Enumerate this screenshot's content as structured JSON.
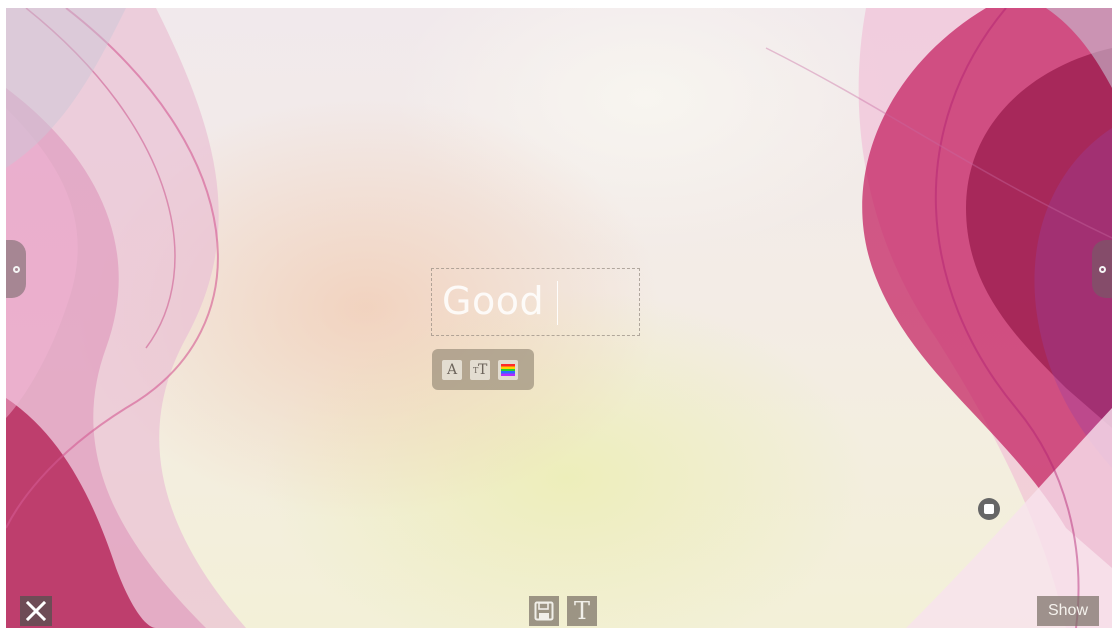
{
  "canvas": {
    "text_value": "Good"
  },
  "format_toolbar": {
    "font_button_label": "A",
    "size_button_small": "T",
    "size_button_big": "T",
    "color_button_icon": "rainbow-color-icon"
  },
  "side_handles": {
    "left_icon": "settings-dot-icon",
    "right_icon": "settings-dot-icon"
  },
  "record_indicator": {
    "icon": "stop-icon"
  },
  "bottom_bar": {
    "close_icon": "close-icon",
    "save_icon": "save-icon",
    "text_button_label": "T",
    "show_label": "Show"
  },
  "colors": {
    "wave_magenta": "#c2185b",
    "wave_pink": "#e880b8",
    "wave_light": "#f4c6dc",
    "background_cream": "#f3f0d8",
    "button_gray": "#786e64"
  }
}
